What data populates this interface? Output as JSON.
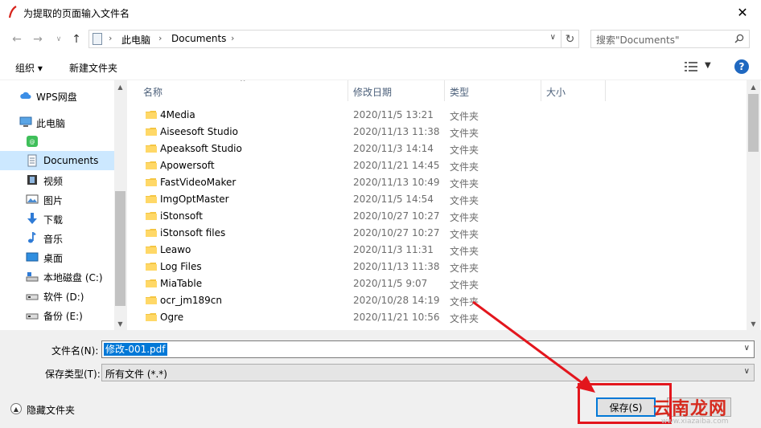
{
  "window": {
    "title": "为提取的页面输入文件名",
    "close_glyph": "✕"
  },
  "address": {
    "segments": [
      "此电脑",
      "Documents"
    ],
    "separator": "›",
    "search_placeholder": "搜索\"Documents\""
  },
  "toolbar": {
    "organize_label": "组织 ▾",
    "new_folder_label": "新建文件夹",
    "help_label": "?"
  },
  "sidebar": {
    "items": [
      {
        "label": "WPS网盘",
        "icon": "cloud-icon"
      },
      {
        "label": "此电脑",
        "icon": "computer-icon"
      },
      {
        "label": "",
        "icon": "wps-app-icon"
      },
      {
        "label": "Documents",
        "icon": "documents-icon",
        "selected": true
      },
      {
        "label": "视频",
        "icon": "video-icon"
      },
      {
        "label": "图片",
        "icon": "pictures-icon"
      },
      {
        "label": "下载",
        "icon": "download-icon"
      },
      {
        "label": "音乐",
        "icon": "music-icon"
      },
      {
        "label": "桌面",
        "icon": "desktop-icon"
      },
      {
        "label": "本地磁盘 (C:)",
        "icon": "drive-c-icon"
      },
      {
        "label": "软件 (D:)",
        "icon": "drive-icon"
      },
      {
        "label": "备份 (E:)",
        "icon": "drive-icon"
      }
    ]
  },
  "files": {
    "columns": [
      "名称",
      "修改日期",
      "类型",
      "大小"
    ],
    "rows": [
      {
        "name": "4Media",
        "date": "2020/11/5 13:21",
        "type": "文件夹"
      },
      {
        "name": "Aiseesoft Studio",
        "date": "2020/11/13 11:38",
        "type": "文件夹"
      },
      {
        "name": "Apeaksoft Studio",
        "date": "2020/11/3 14:14",
        "type": "文件夹"
      },
      {
        "name": "Apowersoft",
        "date": "2020/11/21 14:45",
        "type": "文件夹"
      },
      {
        "name": "FastVideoMaker",
        "date": "2020/11/13 10:49",
        "type": "文件夹"
      },
      {
        "name": "ImgOptMaster",
        "date": "2020/11/5 14:54",
        "type": "文件夹"
      },
      {
        "name": "iStonsoft",
        "date": "2020/10/27 10:27",
        "type": "文件夹"
      },
      {
        "name": "iStonsoft files",
        "date": "2020/10/27 10:27",
        "type": "文件夹"
      },
      {
        "name": "Leawo",
        "date": "2020/11/3 11:31",
        "type": "文件夹"
      },
      {
        "name": "Log Files",
        "date": "2020/11/13 11:38",
        "type": "文件夹"
      },
      {
        "name": "MiaTable",
        "date": "2020/11/5 9:07",
        "type": "文件夹"
      },
      {
        "name": "ocr_jm189cn",
        "date": "2020/10/28 14:19",
        "type": "文件夹"
      },
      {
        "name": "Ogre",
        "date": "2020/11/21 10:56",
        "type": "文件夹"
      }
    ]
  },
  "footer": {
    "filename_label": "文件名(N):",
    "filename_value": "修改-001.pdf",
    "filetype_label": "保存类型(T):",
    "filetype_value": "所有文件 (*.*)",
    "hide_folders_label": "隐藏文件夹",
    "save_label": "保存(S)"
  },
  "watermark": {
    "text": "云南龙网",
    "sub": "www.xiazaiba.com"
  },
  "colors": {
    "accent": "#0078d7",
    "annotation": "#e3161d",
    "selected_bg": "#cce8ff",
    "folder": "#f4c542"
  }
}
